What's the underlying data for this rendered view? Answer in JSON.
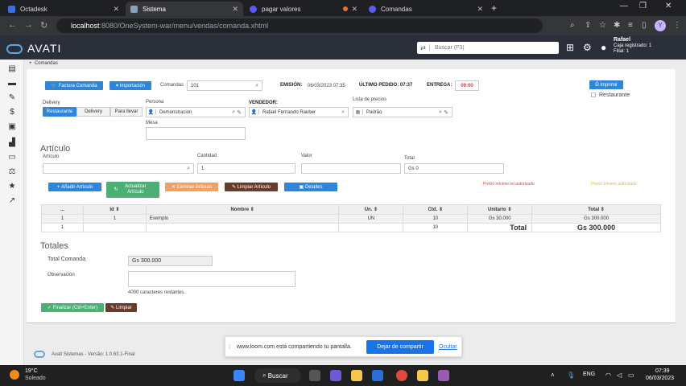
{
  "browser": {
    "tabs": [
      {
        "label": "Octadesk",
        "color": "#3b6fe8"
      },
      {
        "label": "Sistema",
        "color": "#8aa0b8"
      },
      {
        "label": "pagar valores",
        "color": "#5b5bf0"
      },
      {
        "label": "Comandas",
        "color": "#5b5bf0"
      }
    ],
    "url_host": "localhost",
    "url_path": ":8080/OneSystem-war/menu/vendas/comanda.xhtml",
    "profile_letter": "Y"
  },
  "header": {
    "logo": "AVATI",
    "search_placeholder": "Buscar (F3)",
    "user_name": "Rafael",
    "user_line1": "Caja registrado: 1",
    "user_line2": "Filial: 1"
  },
  "breadcrumb": "Comandas",
  "toolbar": {
    "factura": "Factura Comanda",
    "importacion": "Importación",
    "comandas_label": "Comandas",
    "comandas_value": "101",
    "emision_label": "EMISIÓN:",
    "emision_value": "06/03/2023 07:35",
    "ultimo_label": "ÚLTIMO PEDIDO: 07:37",
    "entrega_label": "ENTREGA:",
    "entrega_value": "09:00",
    "imprimir": "Imprimir",
    "restaurante_check": "Restaurante"
  },
  "delivery": {
    "label": "Delivery",
    "options": [
      "Restaurante",
      "Delivery",
      "Para llevar"
    ]
  },
  "persona": {
    "label": "Persona",
    "value": "Demonstracion"
  },
  "vendedor": {
    "label": "VENDEDOR:",
    "value": "Rafael Fernando Rauber"
  },
  "lista": {
    "label": "Lista de precios",
    "value": "Padrão"
  },
  "mesa": {
    "label": "Mesa",
    "value": ""
  },
  "articulo": {
    "title": "Artículo",
    "articulo_label": "Artículo",
    "cantidad_label": "Cantidad",
    "cantidad_value": "1",
    "valor_label": "Valor",
    "total_label": "Total",
    "total_value": "Gs 0"
  },
  "actions": {
    "anadir": "Añadir Artículo",
    "actualizar": "Actualizar Artículo",
    "eliminar": "Eliminar Artículo",
    "limpiar": "Limpiar Artículo",
    "detalles": "Detalles",
    "warn1": "Precio mínimo no autorizado",
    "warn2": "Precio mínimo autorizado"
  },
  "table": {
    "headers": [
      "...",
      "Id",
      "Nombre",
      "Un.",
      "Ctd.",
      "Unitario",
      "Total"
    ],
    "rows": [
      [
        "1",
        "1",
        "Exemplo",
        "UN",
        "10",
        "Gs 30.000",
        "Gs 300.000"
      ]
    ],
    "footer": {
      "index": "1",
      "qty": "10",
      "total_label": "Total",
      "total_value": "Gs 300.000"
    }
  },
  "totales": {
    "title": "Totales",
    "total_comanda_label": "Total Comanda",
    "total_comanda_value": "Gs 300.000",
    "observacion_label": "Observación",
    "remaining": "4000 caracteres restantes.",
    "finalizar": "Finalizar (Ctrl+Enter)",
    "limpiar": "Limpiar"
  },
  "footer_text": "Avati Sistemas - Versão: 1.0.63.1-Final",
  "share": {
    "text": "www.loom.com está compartiendo tu pantalla.",
    "stop": "Dejar de compartir",
    "hide": "Ocultar"
  },
  "taskbar": {
    "weather_temp": "19°C",
    "weather_desc": "Soleado",
    "search": "Buscar",
    "lang": "ENG",
    "time": "07:39",
    "date": "06/03/2023"
  }
}
